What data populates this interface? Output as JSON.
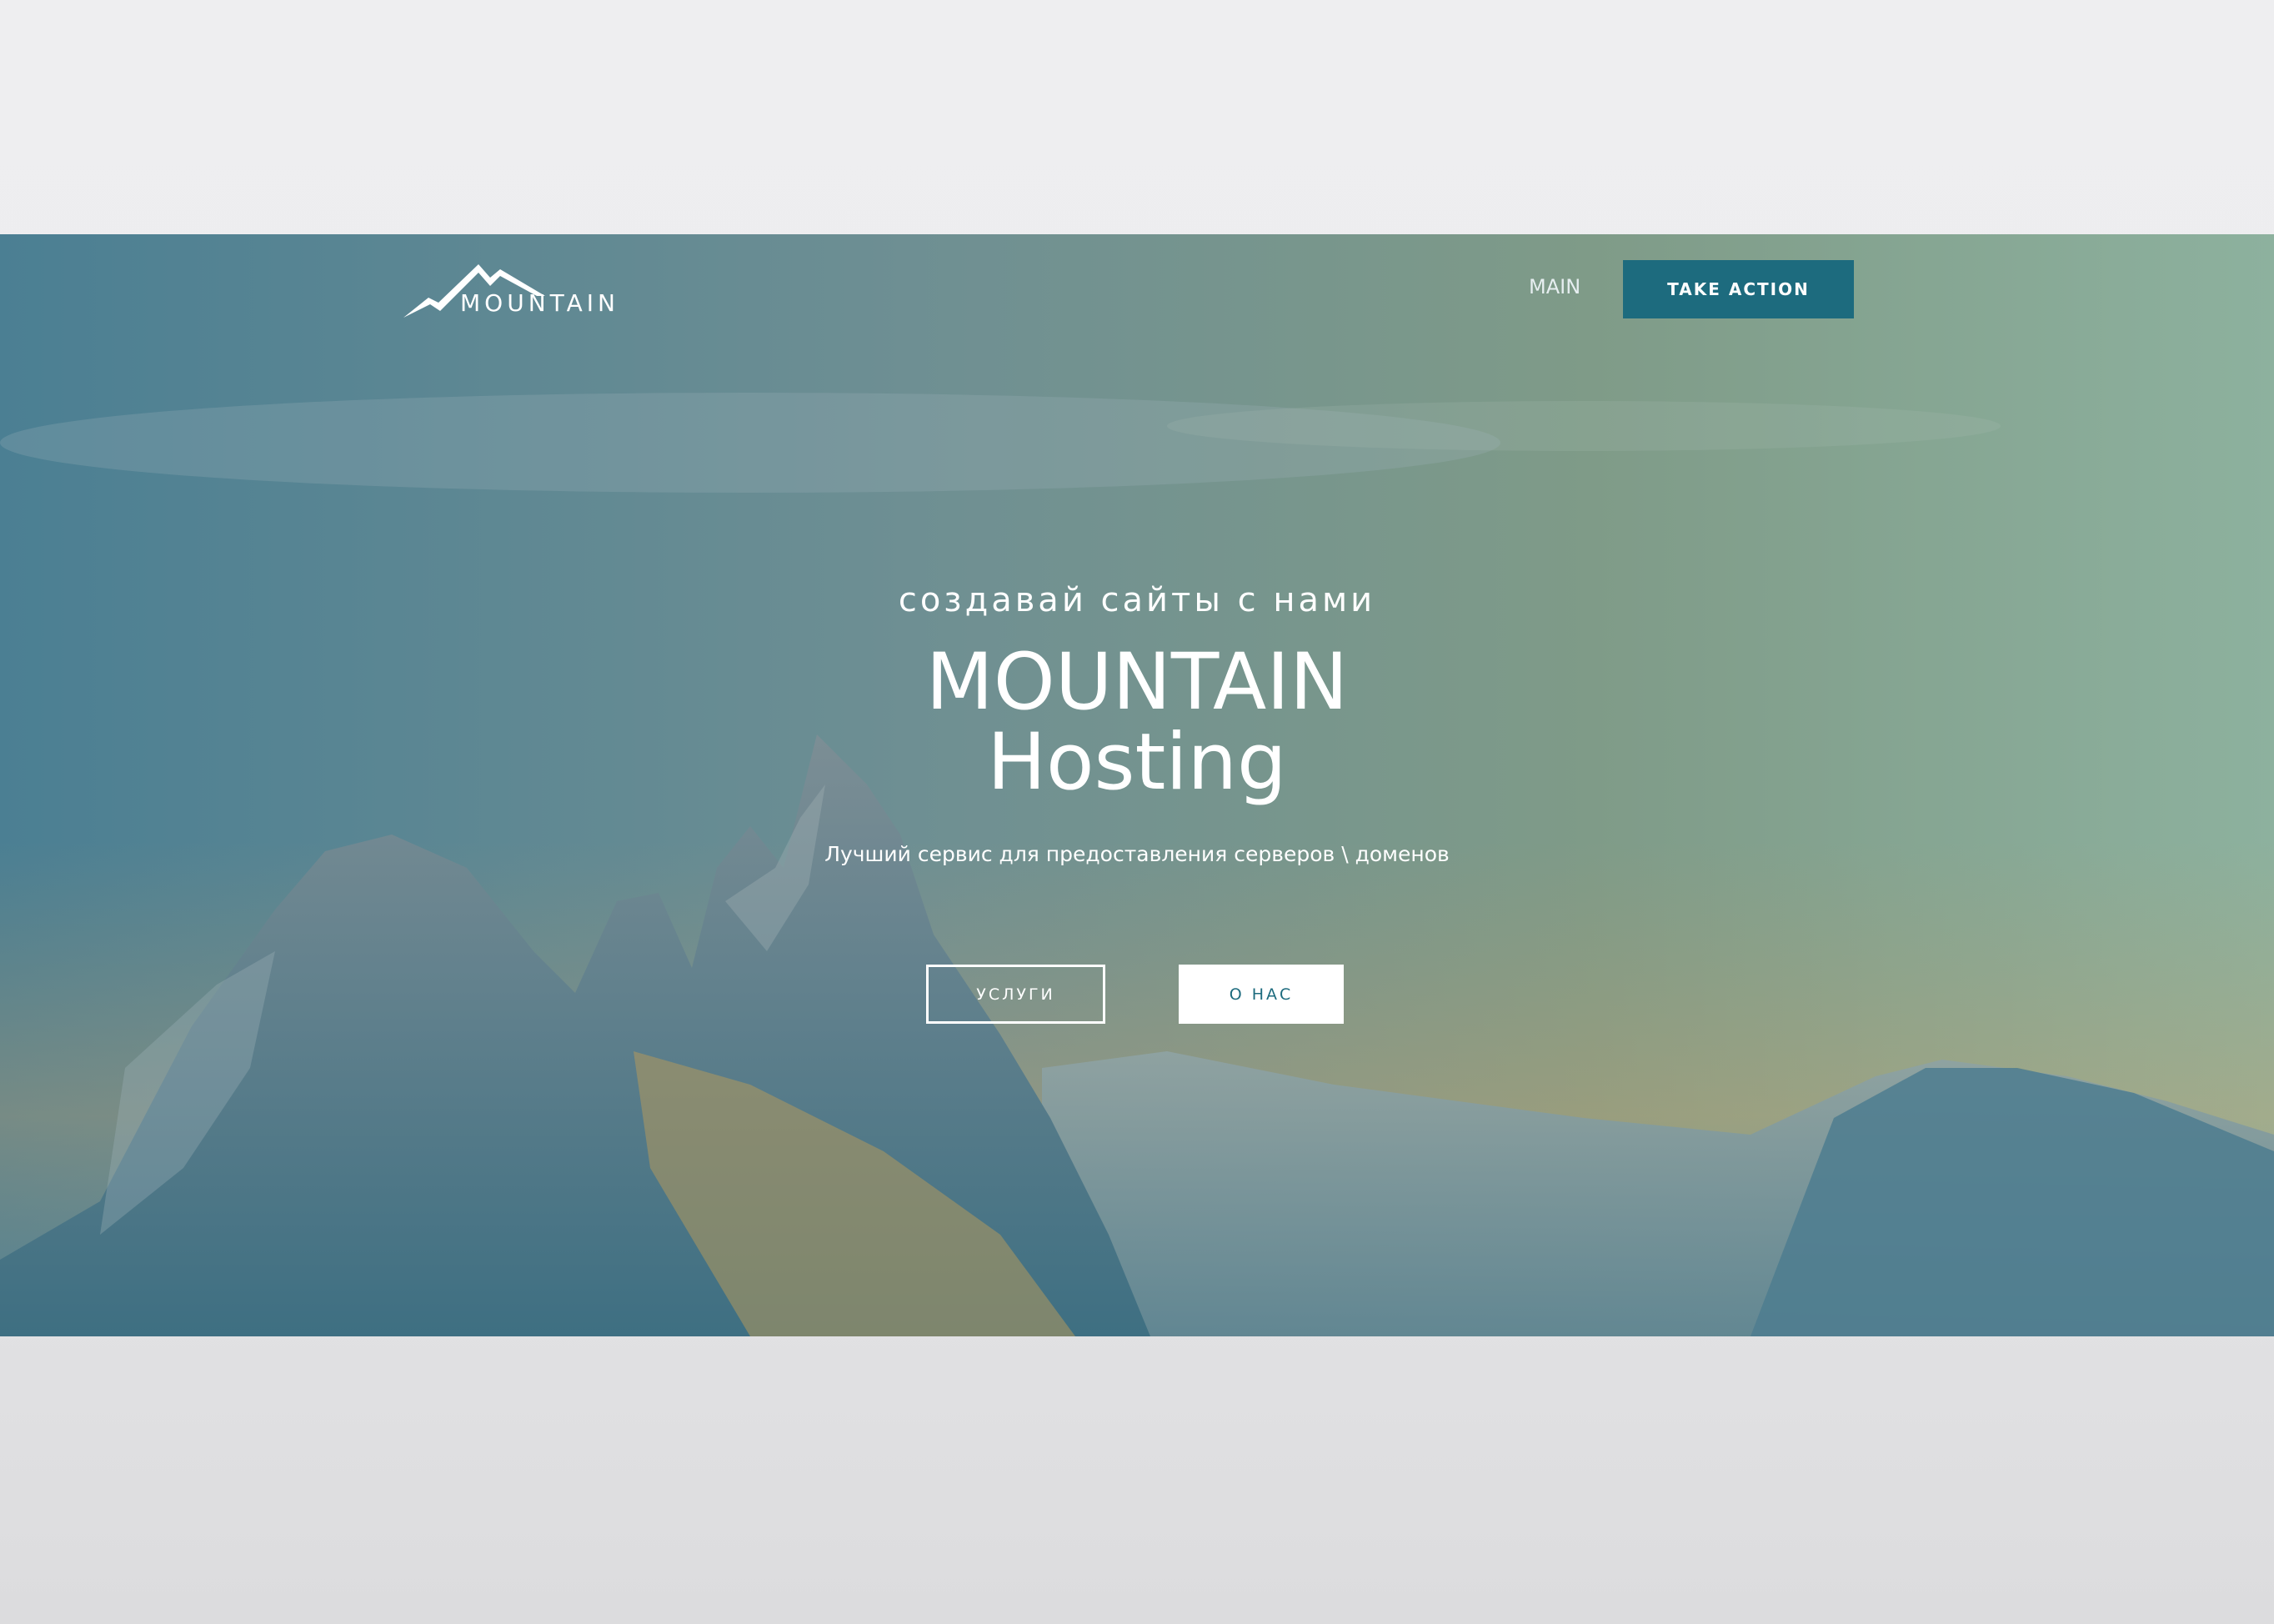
{
  "header": {
    "logo_text": "MOUNTAIN",
    "logo_icon": "mountain-peaks-icon",
    "nav_main": "MAIN",
    "cta_label": "TAKE ACTION"
  },
  "hero": {
    "tagline": "создавай сайты с нами",
    "title_line1": "MOUNTAIN",
    "title_line2": "Hosting",
    "subtitle": "Лучший сервис для предоставления серверов \\ доменов",
    "btn_services": "УСЛУГИ",
    "btn_about": "О НАС"
  },
  "colors": {
    "accent": "#1d6b7e",
    "page_background": "#eeeef0",
    "text_on_hero": "#ffffff"
  }
}
